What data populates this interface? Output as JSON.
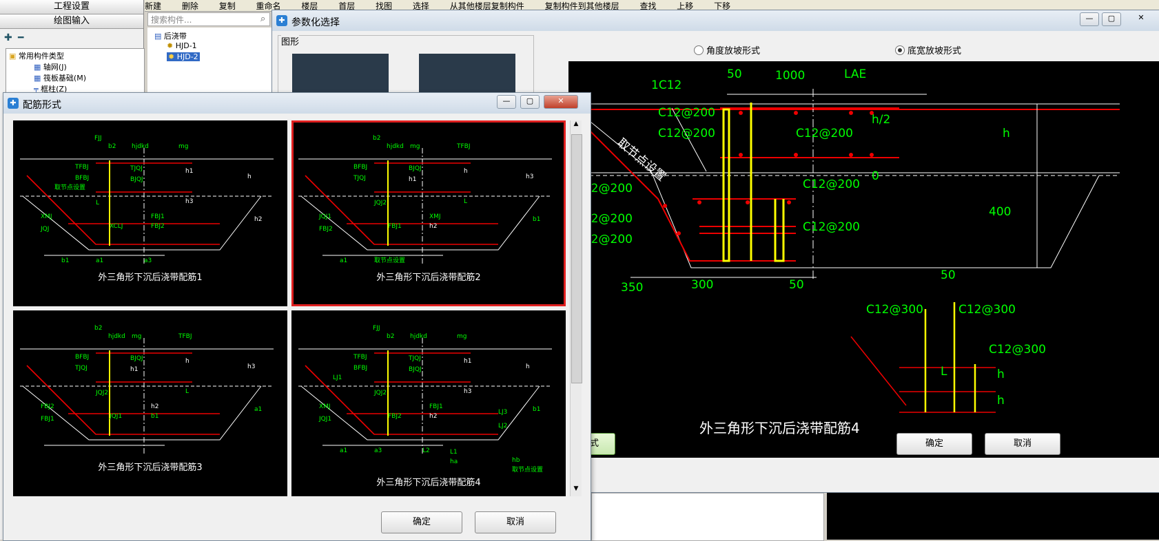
{
  "toolbar": {
    "items": [
      "新建",
      "删除",
      "复制",
      "重命名",
      "楼层",
      "首层",
      "找图",
      "选择",
      "从其他楼层复制构件",
      "复制构件到其他楼层",
      "查找",
      "上移",
      "下移"
    ]
  },
  "nav": {
    "engineering": "工程设置",
    "drawing": "绘图输入"
  },
  "tree": {
    "root": "常用构件类型",
    "items": [
      "轴网(J)",
      "筏板基础(M)",
      "框柱(Z)"
    ]
  },
  "search": {
    "placeholder": "搜索构件..."
  },
  "components": {
    "group": "后浇带",
    "items": [
      "HJD-1",
      "HJD-2"
    ]
  },
  "param_dialog": {
    "title": "参数化选择",
    "group_label": "图形",
    "radio_angle": "角度放坡形式",
    "radio_width": "底宽放坡形式",
    "selected": "radio_width",
    "form_button": "配筋形式",
    "ok": "确定",
    "cancel": "取消",
    "drawing": {
      "caption": "外三角形下沉后浇带配筋4",
      "labels": [
        "1C12",
        "50",
        "1000",
        "LAE",
        "h/2",
        "h",
        "0",
        "400",
        "取节点设置",
        "350",
        "300",
        "50"
      ],
      "rebar": [
        "C12@200",
        "C12@200",
        "C12@200",
        "C12@200",
        "C12@200",
        "C12@200",
        "C12@200",
        "C12@200"
      ],
      "detail_labels": [
        "50",
        "C12@300",
        "C12@300",
        "C12@300",
        "L",
        "h",
        "h"
      ]
    }
  },
  "form_dialog": {
    "title": "配筋形式",
    "ok": "确定",
    "cancel": "取消",
    "selected_index": 1,
    "options": [
      {
        "caption": "外三角形下沉后浇带配筋1",
        "labels": [
          "FJJ",
          "b2",
          "hjdkd",
          "mg",
          "TFBJ",
          "BFBJ",
          "TJQJ",
          "BJQJ",
          "h1",
          "h",
          "h3",
          "L",
          "XMJ",
          "JQJ",
          "XCLJ",
          "FBJ1",
          "FBJ2",
          "h2",
          "b1",
          "a1",
          "a3",
          "取节点设置"
        ]
      },
      {
        "caption": "外三角形下沉后浇带配筋2",
        "labels": [
          "b2",
          "hjdkd",
          "mg",
          "TFBJ",
          "BFBJ",
          "TJQJ",
          "BJQJ",
          "h1",
          "h",
          "h3",
          "L",
          "JQJ2",
          "JQJ1",
          "FBJ2",
          "FBJ1",
          "XMJ",
          "h2",
          "b1",
          "a1",
          "取节点设置"
        ]
      },
      {
        "caption": "外三角形下沉后浇带配筋3",
        "labels": [
          "b2",
          "hjdkd",
          "mg",
          "TFBJ",
          "BFBJ",
          "TJQJ",
          "BJQJ",
          "h1",
          "h",
          "h3",
          "L",
          "JQJ2",
          "FBJ2",
          "FBJ1",
          "JQJ1",
          "h2",
          "b1",
          "a1"
        ]
      },
      {
        "caption": "外三角形下沉后浇带配筋4",
        "labels": [
          "FJJ",
          "b2",
          "hjdkd",
          "mg",
          "TFBJ",
          "BFBJ",
          "TJQJ",
          "BJQJ",
          "h1",
          "h",
          "h3",
          "JQJ2",
          "XMJ",
          "JQJ1",
          "FBJ2",
          "FBJ1",
          "h2",
          "b1",
          "a1",
          "a3",
          "L2",
          "LJ1",
          "LJ3",
          "LJ2",
          "L1",
          "ha",
          "hb",
          "取节点设置"
        ]
      }
    ]
  }
}
